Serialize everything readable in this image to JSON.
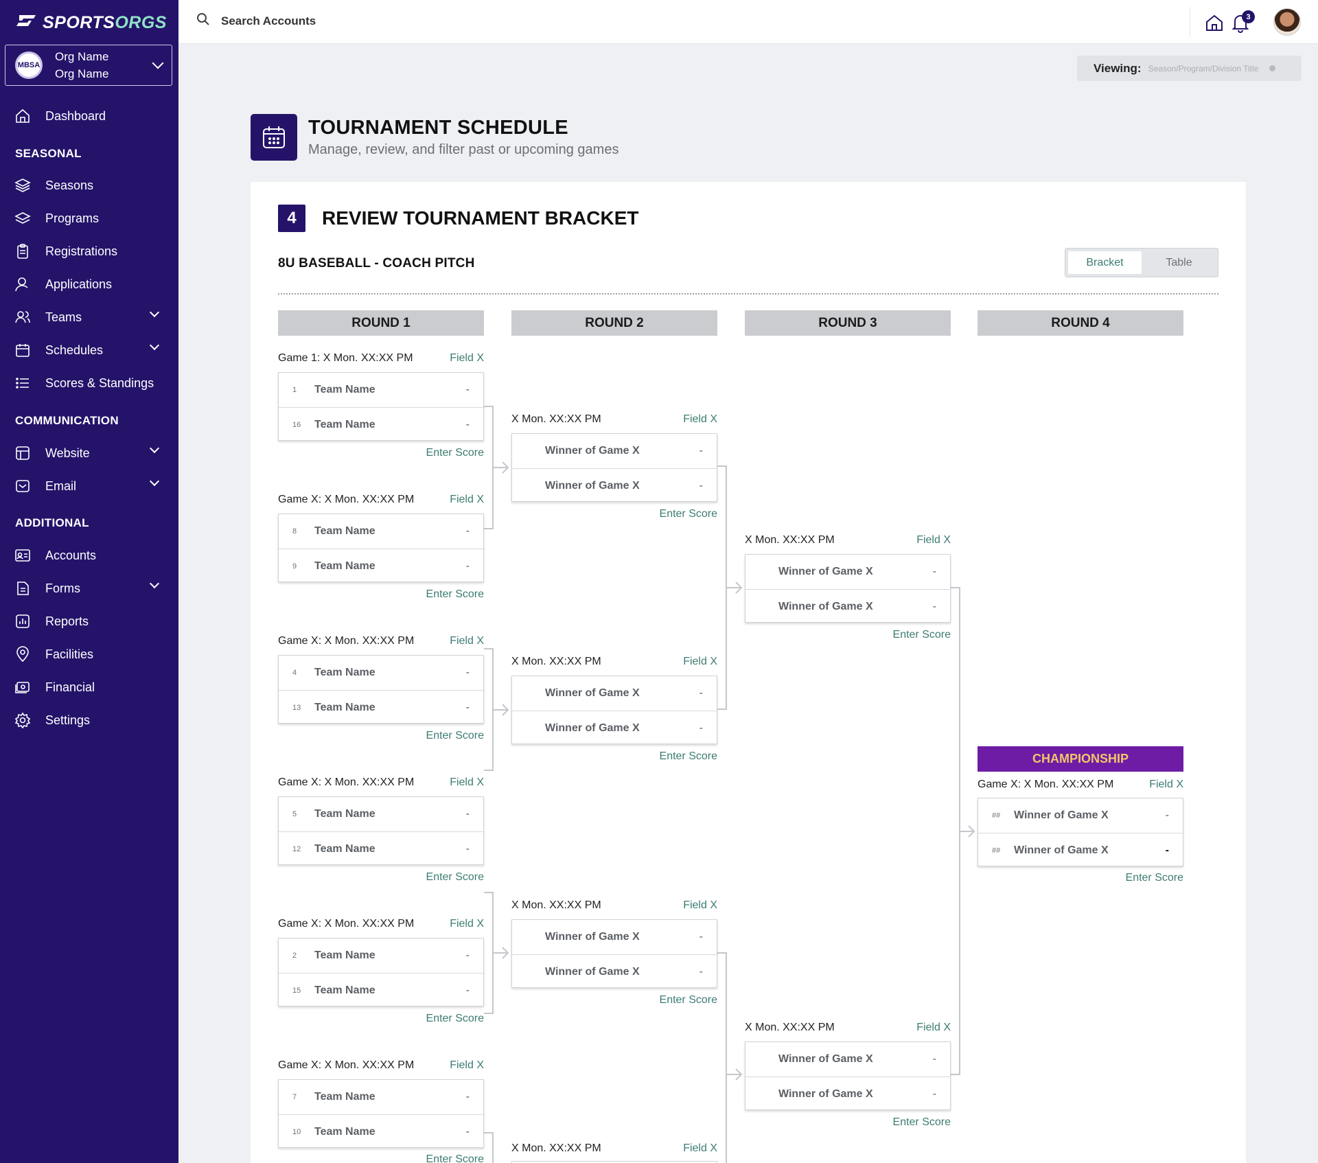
{
  "brand": {
    "name_left": "SPORTS",
    "name_right": "ORGS"
  },
  "org": {
    "badge": "MBSA",
    "line1": "Org Name",
    "line2": "Org Name"
  },
  "nav": {
    "dashboard": "Dashboard",
    "seasonal_header": "SEASONAL",
    "seasons": "Seasons",
    "programs": "Programs",
    "registrations": "Registrations",
    "applications": "Applications",
    "teams": "Teams",
    "schedules": "Schedules",
    "scores": "Scores & Standings",
    "communication_header": "COMMUNICATION",
    "website": "Website",
    "email": "Email",
    "additional_header": "ADDITIONAL",
    "accounts": "Accounts",
    "forms": "Forms",
    "reports": "Reports",
    "facilities": "Facilities",
    "financial": "Financial",
    "settings": "Settings"
  },
  "topbar": {
    "search_label": "Search Accounts",
    "notification_count": "3"
  },
  "viewing": {
    "label": "Viewing:",
    "value": "Season/Program/Division Title"
  },
  "page": {
    "title": "TOURNAMENT SCHEDULE",
    "subtitle": "Manage, review, and filter past or upcoming games"
  },
  "step": {
    "number": "4",
    "title": "REVIEW TOURNAMENT BRACKET"
  },
  "division": "8U BASEBALL - COACH PITCH",
  "view_toggle": {
    "bracket": "Bracket",
    "table": "Table",
    "active": "Bracket"
  },
  "rounds": [
    "ROUND 1",
    "ROUND 2",
    "ROUND 3",
    "ROUND 4"
  ],
  "enter_score": "Enter Score",
  "round1_games": [
    {
      "label": "Game 1: X Mon. XX:XX PM",
      "field": "Field X",
      "teams": [
        {
          "seed": "1",
          "name": "Team Name",
          "score": "-"
        },
        {
          "seed": "16",
          "name": "Team Name",
          "score": "-"
        }
      ]
    },
    {
      "label": "Game X: X Mon. XX:XX PM",
      "field": "Field X",
      "teams": [
        {
          "seed": "8",
          "name": "Team Name",
          "score": "-"
        },
        {
          "seed": "9",
          "name": "Team Name",
          "score": "-"
        }
      ]
    },
    {
      "label": "Game X: X Mon. XX:XX PM",
      "field": "Field X",
      "teams": [
        {
          "seed": "4",
          "name": "Team Name",
          "score": "-"
        },
        {
          "seed": "13",
          "name": "Team Name",
          "score": "-"
        }
      ]
    },
    {
      "label": "Game X: X Mon. XX:XX PM",
      "field": "Field X",
      "teams": [
        {
          "seed": "5",
          "name": "Team Name",
          "score": "-"
        },
        {
          "seed": "12",
          "name": "Team Name",
          "score": "-"
        }
      ]
    },
    {
      "label": "Game X: X Mon. XX:XX PM",
      "field": "Field X",
      "teams": [
        {
          "seed": "2",
          "name": "Team Name",
          "score": "-"
        },
        {
          "seed": "15",
          "name": "Team Name",
          "score": "-"
        }
      ]
    },
    {
      "label": "Game X: X Mon. XX:XX PM",
      "field": "Field X",
      "teams": [
        {
          "seed": "7",
          "name": "Team Name",
          "score": "-"
        },
        {
          "seed": "10",
          "name": "Team Name",
          "score": "-"
        }
      ]
    }
  ],
  "round2_games": [
    {
      "label": "X Mon. XX:XX PM",
      "field": "Field X",
      "teams": [
        {
          "name": "Winner of Game X",
          "score": "-"
        },
        {
          "name": "Winner of Game X",
          "score": "-"
        }
      ]
    },
    {
      "label": "X Mon. XX:XX PM",
      "field": "Field X",
      "teams": [
        {
          "name": "Winner of Game X",
          "score": "-"
        },
        {
          "name": "Winner of Game X",
          "score": "-"
        }
      ]
    },
    {
      "label": "X Mon. XX:XX PM",
      "field": "Field X",
      "teams": [
        {
          "name": "Winner of Game X",
          "score": "-"
        },
        {
          "name": "Winner of Game X",
          "score": "-"
        }
      ]
    },
    {
      "label": "X Mon. XX:XX PM",
      "field": "Field X",
      "teams": []
    }
  ],
  "round3_games": [
    {
      "label": "X Mon. XX:XX PM",
      "field": "Field X",
      "teams": [
        {
          "name": "Winner of Game X",
          "score": "-"
        },
        {
          "name": "Winner of Game X",
          "score": "-"
        }
      ]
    },
    {
      "label": "X Mon. XX:XX PM",
      "field": "Field X",
      "teams": [
        {
          "name": "Winner of Game X",
          "score": "-"
        },
        {
          "name": "Winner of Game X",
          "score": "-"
        }
      ]
    }
  ],
  "championship": {
    "header": "CHAMPIONSHIP",
    "label": "Game X: X Mon. XX:XX PM",
    "field": "Field X",
    "teams": [
      {
        "seed": "##",
        "name": "Winner of Game X",
        "score": "-"
      },
      {
        "seed": "##",
        "name": "Winner of Game X",
        "score": "-"
      }
    ]
  },
  "colors": {
    "sidebar": "#25136a",
    "accent_teal": "#3c7c72",
    "championship": "#6e1ca5",
    "championship_text": "#f2c56a"
  }
}
